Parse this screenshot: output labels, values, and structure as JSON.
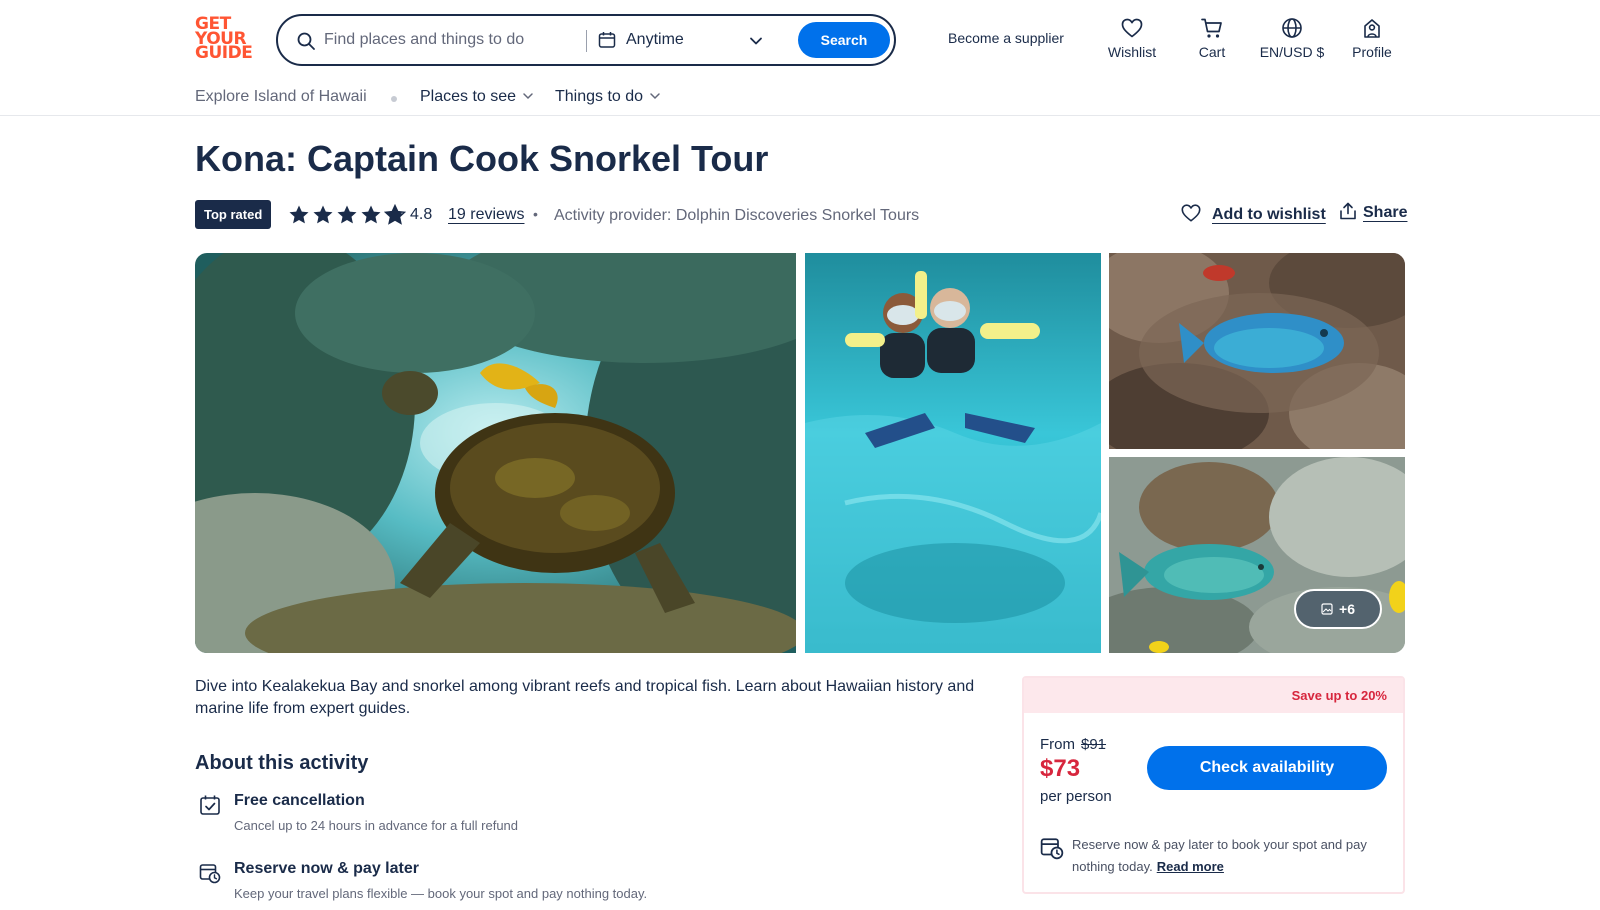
{
  "brand": {
    "logo_lines": [
      "GET",
      "YOUR",
      "GUIDE"
    ],
    "color": "#ff5533"
  },
  "search": {
    "placeholder": "Find places and things to do",
    "date_label": "Anytime",
    "button_label": "Search"
  },
  "header": {
    "supplier_link": "Become a supplier",
    "actions": [
      {
        "label": "Wishlist",
        "icon": "heart-icon"
      },
      {
        "label": "Cart",
        "icon": "cart-icon"
      },
      {
        "label": "EN/USD $",
        "icon": "globe-icon"
      },
      {
        "label": "Profile",
        "icon": "profile-icon"
      }
    ]
  },
  "subnav": {
    "explore": "Explore Island of Hawaii",
    "items": [
      {
        "label": "Places to see"
      },
      {
        "label": "Things to do"
      }
    ]
  },
  "activity": {
    "title": "Kona: Captain Cook Snorkel Tour",
    "badge": "Top rated",
    "rating": "4.8",
    "rating_value": 4.8,
    "reviews": "19 reviews",
    "provider": "Activity provider: Dolphin Discoveries Snorkel Tours",
    "wishlist_label": "Add to wishlist",
    "share_label": "Share"
  },
  "gallery": {
    "more_photos": "+6",
    "photos": [
      {
        "subject": "sea turtle swimming over coral reef"
      },
      {
        "subject": "two snorkelers waving in turquoise water"
      },
      {
        "subject": "blue parrotfish above coral"
      },
      {
        "subject": "green parrotfish near coral head"
      }
    ]
  },
  "description": "Dive into Kealakekua Bay and snorkel among vibrant reefs and tropical fish. Learn about Hawaiian history and marine life from expert guides.",
  "about": {
    "title": "About this activity",
    "features": [
      {
        "icon": "calendar-check-icon",
        "title": "Free cancellation",
        "description": "Cancel up to 24 hours in advance for a full refund"
      },
      {
        "icon": "reserve-later-icon",
        "title": "Reserve now & pay later",
        "description": "Keep your travel plans flexible — book your spot and pay nothing today."
      }
    ]
  },
  "booking": {
    "save_text": "Save up to 20%",
    "from_label": "From",
    "old_price": "$91",
    "price": "$73",
    "per_person": "per person",
    "cta": "Check availability",
    "rnpl_text": "Reserve now & pay later to book your spot and pay nothing today.",
    "read_more": "Read more"
  },
  "colors": {
    "primary_blue": "#0071eb",
    "navy_text": "#1a2b49",
    "sale_red": "#d7263d",
    "sale_banner_bg": "#fde8ec"
  }
}
